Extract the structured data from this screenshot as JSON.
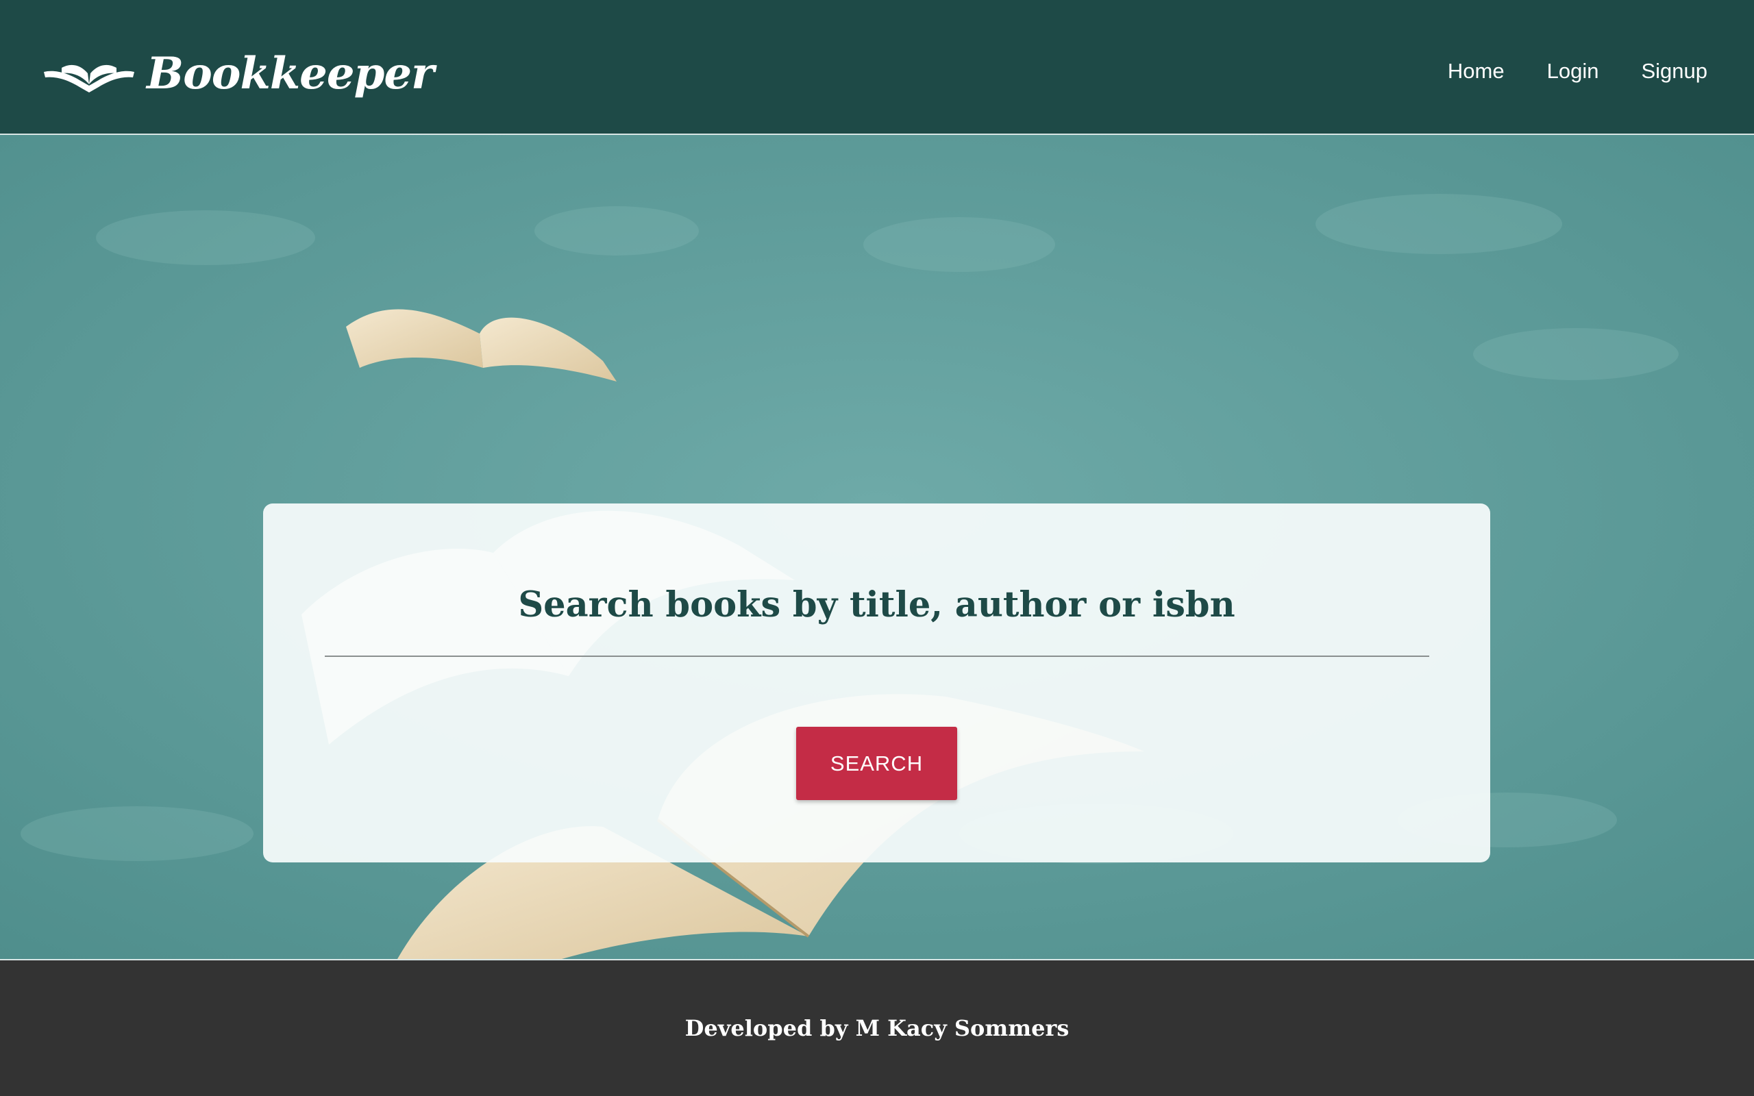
{
  "header": {
    "brand": "Bookkeeper",
    "nav": [
      "Home",
      "Login",
      "Signup"
    ]
  },
  "search": {
    "title": "Search books by title, author or isbn",
    "input_value": "",
    "button_label": "Search"
  },
  "footer": {
    "credit": "Developed by M Kacy Sommers"
  },
  "colors": {
    "header_bg": "#1e4a47",
    "hero_bg": "#5e9d9b",
    "button_bg": "#c42c46",
    "footer_bg": "#333333",
    "title_color": "#1e4a47"
  }
}
